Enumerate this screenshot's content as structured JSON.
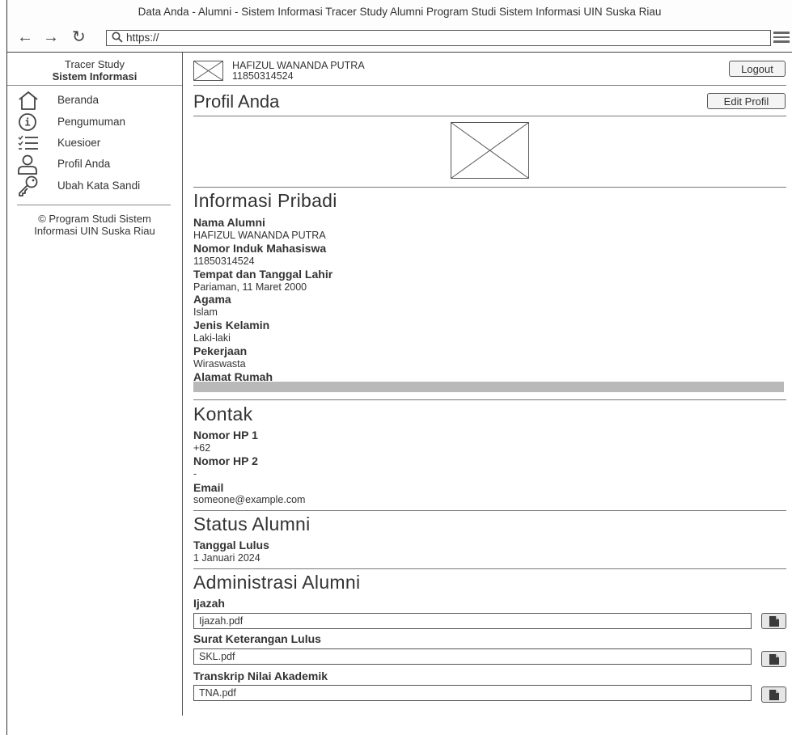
{
  "window": {
    "title": "Data Anda - Alumni - Sistem Informasi Tracer Study Alumni Program Studi Sistem Informasi UIN Suska Riau",
    "url": "https://"
  },
  "sidebar": {
    "brand_line1": "Tracer Study",
    "brand_line2": "Sistem Informasi",
    "items": [
      {
        "label": "Beranda",
        "icon": "home-icon"
      },
      {
        "label": "Pengumuman",
        "icon": "info-icon"
      },
      {
        "label": "Kuesioer",
        "icon": "checklist-icon"
      },
      {
        "label": "Profil Anda",
        "icon": "user-icon"
      },
      {
        "label": "Ubah Kata Sandi",
        "icon": "key-icon"
      }
    ],
    "footer": "© Program Studi Sistem Informasi UIN Suska Riau"
  },
  "header": {
    "user_name": "HAFIZUL WANANDA PUTRA",
    "user_id": "11850314524",
    "logout_label": "Logout"
  },
  "page": {
    "title": "Profil Anda",
    "edit_label": "Edit Profil"
  },
  "personal": {
    "title": "Informasi Pribadi",
    "fields": [
      {
        "label": "Nama Alumni",
        "value": "HAFIZUL WANANDA PUTRA"
      },
      {
        "label": "Nomor Induk Mahasiswa",
        "value": "11850314524"
      },
      {
        "label": "Tempat dan Tanggal Lahir",
        "value": "Pariaman, 11 Maret 2000"
      },
      {
        "label": "Agama",
        "value": "Islam"
      },
      {
        "label": "Jenis Kelamin",
        "value": "Laki-laki"
      },
      {
        "label": "Pekerjaan",
        "value": "Wiraswasta"
      }
    ],
    "address_label": "Alamat Rumah"
  },
  "contact": {
    "title": "Kontak",
    "fields": [
      {
        "label": "Nomor HP 1",
        "value": "+62"
      },
      {
        "label": "Nomor HP 2",
        "value": "-"
      },
      {
        "label": "Email",
        "value": "someone@example.com"
      }
    ]
  },
  "status": {
    "title": "Status Alumni",
    "fields": [
      {
        "label": "Tanggal Lulus",
        "value": "1 Januari 2024"
      }
    ]
  },
  "admin": {
    "title": "Administrasi Alumni",
    "files": [
      {
        "label": "Ijazah",
        "value": "Ijazah.pdf"
      },
      {
        "label": "Surat Keterangan Lulus",
        "value": "SKL.pdf"
      },
      {
        "label": "Transkrip Nilai Akademik",
        "value": "TNA.pdf"
      }
    ]
  }
}
